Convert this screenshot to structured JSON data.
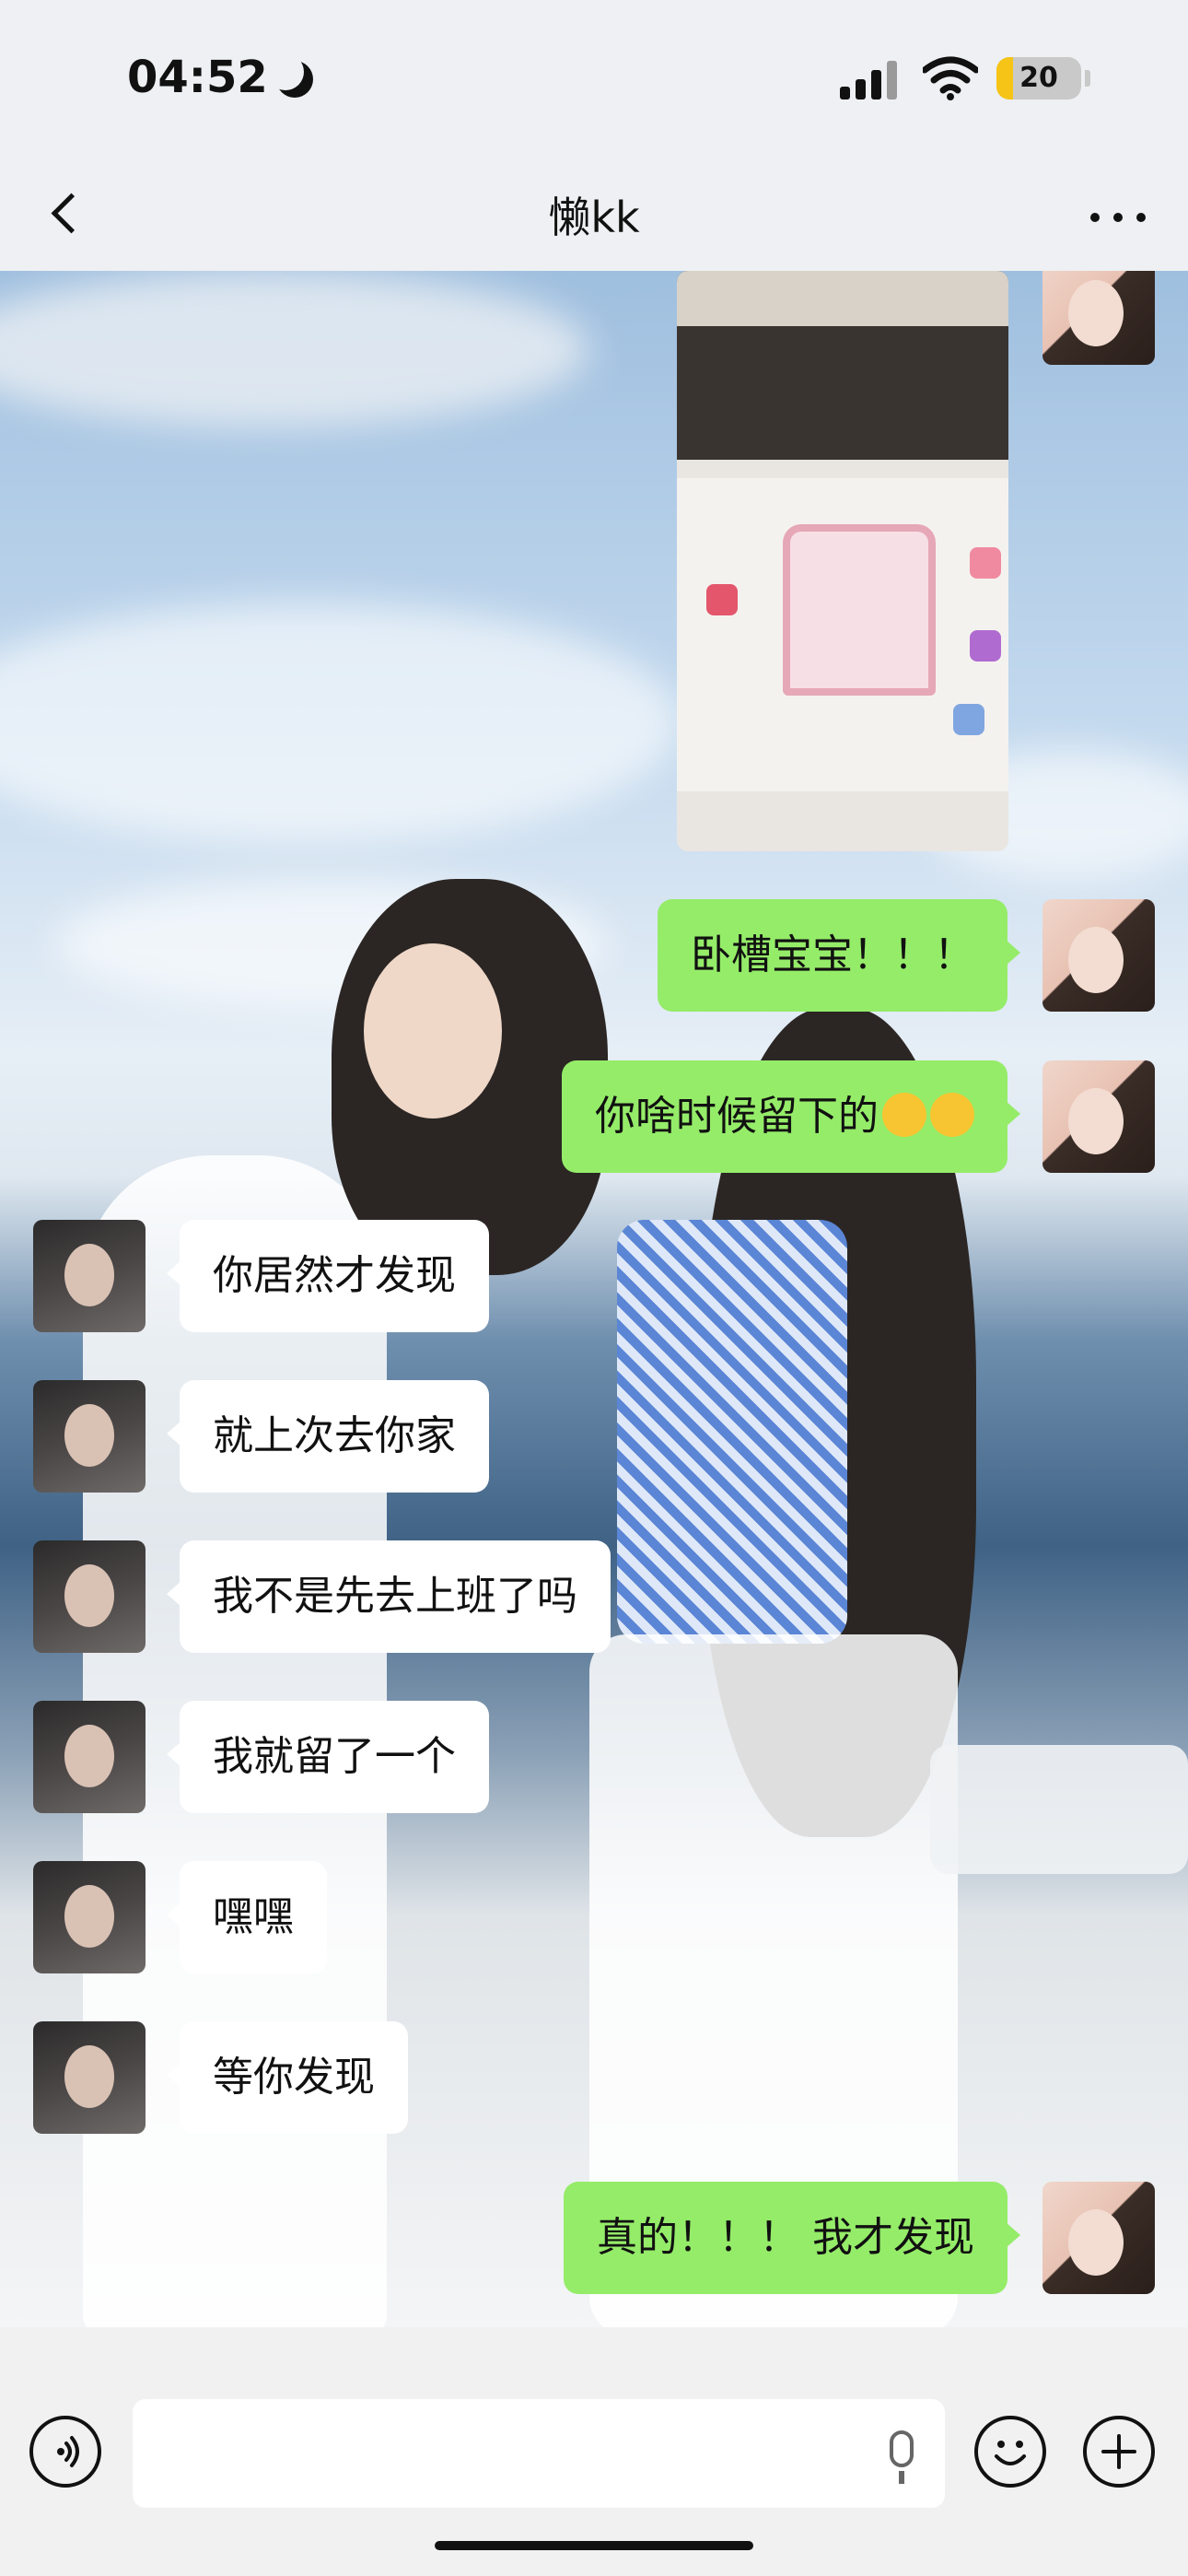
{
  "status_bar": {
    "time": "04:52",
    "moon_icon": "moon-icon",
    "signal_icon": "cellular-signal-icon",
    "wifi_icon": "wifi-icon",
    "battery_level": "20",
    "battery_color": "#f6c416"
  },
  "nav": {
    "title": "懒kk",
    "back_icon": "chevron-left-icon",
    "more_icon": "more-dots-icon"
  },
  "messages": [
    {
      "from": "me",
      "type": "image"
    },
    {
      "from": "me",
      "text": "卧槽宝宝！！！"
    },
    {
      "from": "me",
      "text": "你啥时候留下的",
      "emoji_count": 2
    },
    {
      "from": "friend",
      "text": "你居然才发现"
    },
    {
      "from": "friend",
      "text": "就上次去你家"
    },
    {
      "from": "friend",
      "text": "我不是先去上班了吗"
    },
    {
      "from": "friend",
      "text": "我就留了一个"
    },
    {
      "from": "friend",
      "text": "嘿嘿"
    },
    {
      "from": "friend",
      "text": "等你发现"
    },
    {
      "from": "me",
      "text": "真的！！！ 我才发现"
    }
  ],
  "input_bar": {
    "voice_icon": "voice-mode-icon",
    "mic_icon": "microphone-icon",
    "emoji_icon": "emoji-icon",
    "plus_icon": "plus-icon",
    "text_value": ""
  },
  "colors": {
    "outgoing_bubble": "#95ec69",
    "incoming_bubble": "#ffffff"
  }
}
